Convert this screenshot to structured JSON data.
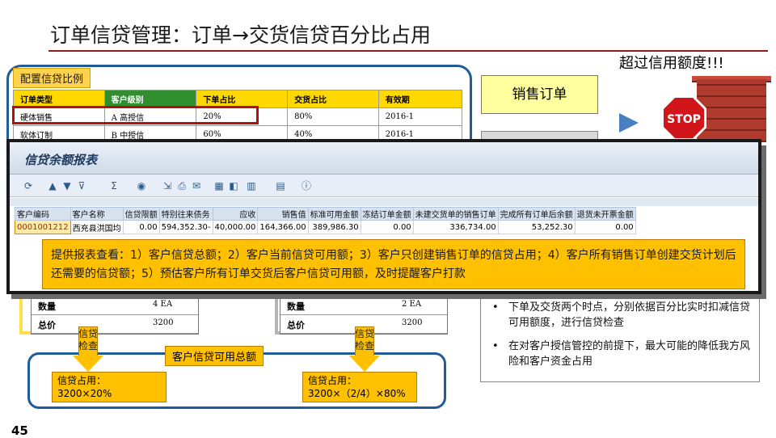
{
  "slide": {
    "title": "订单信贷管理：订单→交货信贷百分比占用",
    "page_number": "45"
  },
  "config": {
    "label": "配置信贷比例",
    "headers": [
      "订单类型",
      "客户级别",
      "下单占比",
      "交货占比",
      "有效期"
    ],
    "rows": [
      [
        "硬体销售",
        "A 高授信",
        "20%",
        "80%",
        "2016-1"
      ],
      [
        "软体订制",
        "B 中授信",
        "60%",
        "40%",
        "2016-1"
      ]
    ]
  },
  "right_panel": {
    "sales_order": "销售订单",
    "over_limit": "超过信用额度!!!",
    "stop_text": "STOP"
  },
  "sap": {
    "window_title": "信贷余额报表",
    "toolbar_icons": [
      "refresh-icon",
      "sort-ascending-icon",
      "sort-descending-icon",
      "filter-icon",
      "sum-icon",
      "subtotal-icon",
      "export-icon",
      "print-icon",
      "mail-icon",
      "layout-icon",
      "change-layout-icon",
      "graphic-icon",
      "grid-icon",
      "info-icon"
    ],
    "columns": [
      "客户编码",
      "客户名称",
      "信贷限额",
      "特别往来债务",
      "应收",
      "销售值",
      "标准可用金额",
      "冻结订单金额",
      "未建交货单的销售订单",
      "完成所有订单后余额",
      "退货未开票金额"
    ],
    "row": [
      "0001001212",
      "西充县洪国均",
      "0.00",
      "594,352.30-",
      "40,000.00",
      "164,366.00",
      "389,986.30",
      "0.00",
      "336,734.00",
      "53,252.30",
      "0.00"
    ],
    "note": "提供报表查看：1）客户信贷总额；2）客户当前信贷可用额；3）客户只创建销售订单的信贷占用；4）客户所有销售订单创建交货计划后还需要的信贷额；5）预估客户所有订单交货后客户信贷可用额，及时提醒客户打款"
  },
  "orders": {
    "left": {
      "qty_label": "数量",
      "qty_value": "4 EA",
      "total_label": "总价",
      "total_value": "3200"
    },
    "right": {
      "qty_label": "数量",
      "qty_value": "2 EA",
      "total_label": "总价",
      "total_value": "3200"
    }
  },
  "flow": {
    "arrow_text": "信贷检查",
    "total_label": "客户信贷可用总额",
    "left_occupy_title": "信贷占用：",
    "left_occupy_formula": "3200×20%",
    "right_occupy_title": "信贷占用：",
    "right_occupy_formula": "3200×（2/4）×80%"
  },
  "bullets": [
    "下单及交货两个时点，分别依据百分比实时扣减信贷可用额度，进行信贷检查",
    "在对客户授信管控的前提下，最大可能的降低我方风险和客户资金占用"
  ],
  "colors": {
    "accent_red": "#8c1c1c",
    "frame_blue": "#1f5c99",
    "note_orange": "#ffc000",
    "header_yellow": "#ffd800",
    "header_green": "#2f8f2f"
  }
}
